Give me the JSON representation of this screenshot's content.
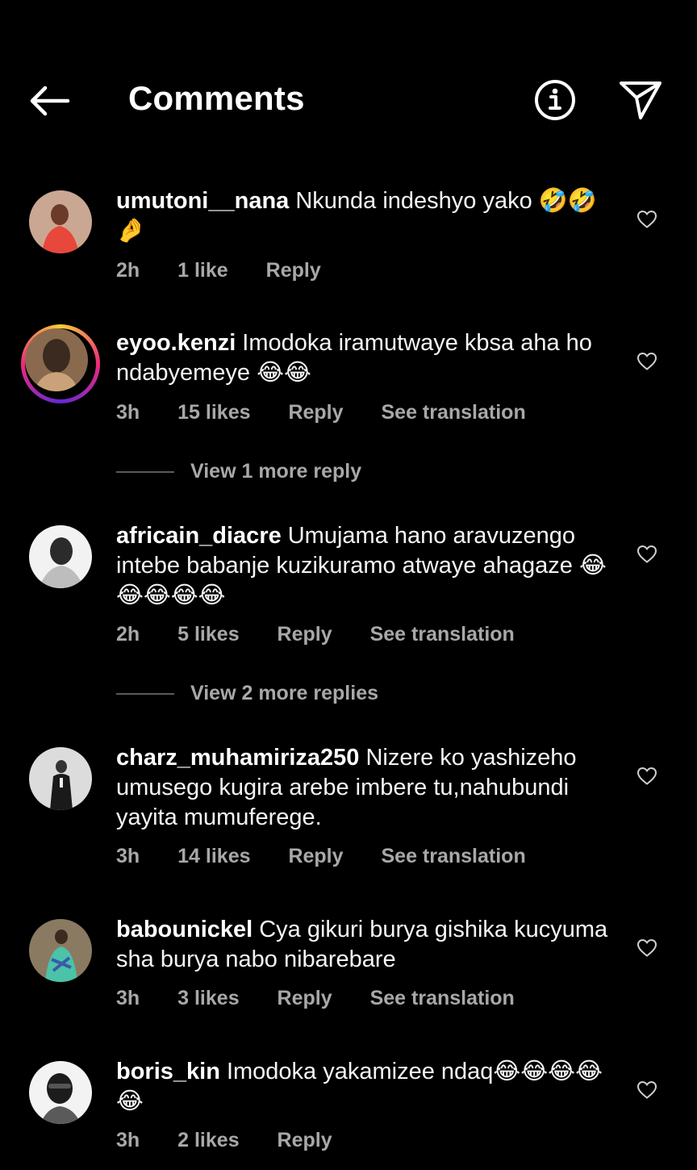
{
  "header": {
    "title": "Comments",
    "back_icon": "arrow-left-icon",
    "info_icon": "info-circle-icon",
    "send_icon": "paper-plane-icon"
  },
  "colors": {
    "background": "#000000",
    "text": "#ffffff",
    "meta": "#a8a8a8",
    "story_ring": [
      "#f9ce34",
      "#ee2a7b",
      "#6228d7"
    ]
  },
  "comments": [
    {
      "username": "umutoni__nana",
      "text": "Nkunda indeshyo yako 🤣🤣🤌",
      "time": "2h",
      "likes": "1 like",
      "reply": "Reply",
      "translate": "",
      "avatar_colors": [
        "#c97a5e",
        "#e84a3c",
        "#f2d9c9"
      ]
    },
    {
      "username": "eyoo.kenzi",
      "text": "Imodoka iramutwaye kbsa aha ho ndabyemeye 😂😂",
      "time": "3h",
      "likes": "15 likes",
      "reply": "Reply",
      "translate": "See translation",
      "avatar_colors": [
        "#3b2a20",
        "#caa27a",
        "#6b4a33"
      ],
      "view_more": "View 1 more reply"
    },
    {
      "username": "africain_diacre",
      "text": "Umujama hano aravuzengo intebe babanje kuzikuramo atwaye ahagaze 😂😂😂😂😂",
      "time": "2h",
      "likes": "5 likes",
      "reply": "Reply",
      "translate": "See translation",
      "avatar_colors": [
        "#e6e6e6",
        "#2a2a2a",
        "#bdbdbd"
      ],
      "view_more": "View 2 more replies"
    },
    {
      "username": "charz_muhamiriza250",
      "text": "Nizere ko yashizeho umusego kugira arebe imbere tu,nahubundi yayita mumuferege.",
      "time": "3h",
      "likes": "14 likes",
      "reply": "Reply",
      "translate": "See translation",
      "avatar_colors": [
        "#d9d9d9",
        "#1a1a1a",
        "#8a8a8a"
      ]
    },
    {
      "username": "babounickel",
      "text": "Cya gikuri burya gishika kucyuma sha burya nabo nibarebare",
      "time": "3h",
      "likes": "3 likes",
      "reply": "Reply",
      "translate": "See translation",
      "avatar_colors": [
        "#7a6a55",
        "#4bc3a8",
        "#3a5aa8"
      ]
    },
    {
      "username": "boris_kin",
      "text": "Imodoka yakamizee ndaq😂😂😂😂😂",
      "time": "3h",
      "likes": "2 likes",
      "reply": "Reply",
      "translate": "",
      "avatar_colors": [
        "#f0f0f0",
        "#1c1c1c",
        "#5a5a5a"
      ]
    }
  ]
}
